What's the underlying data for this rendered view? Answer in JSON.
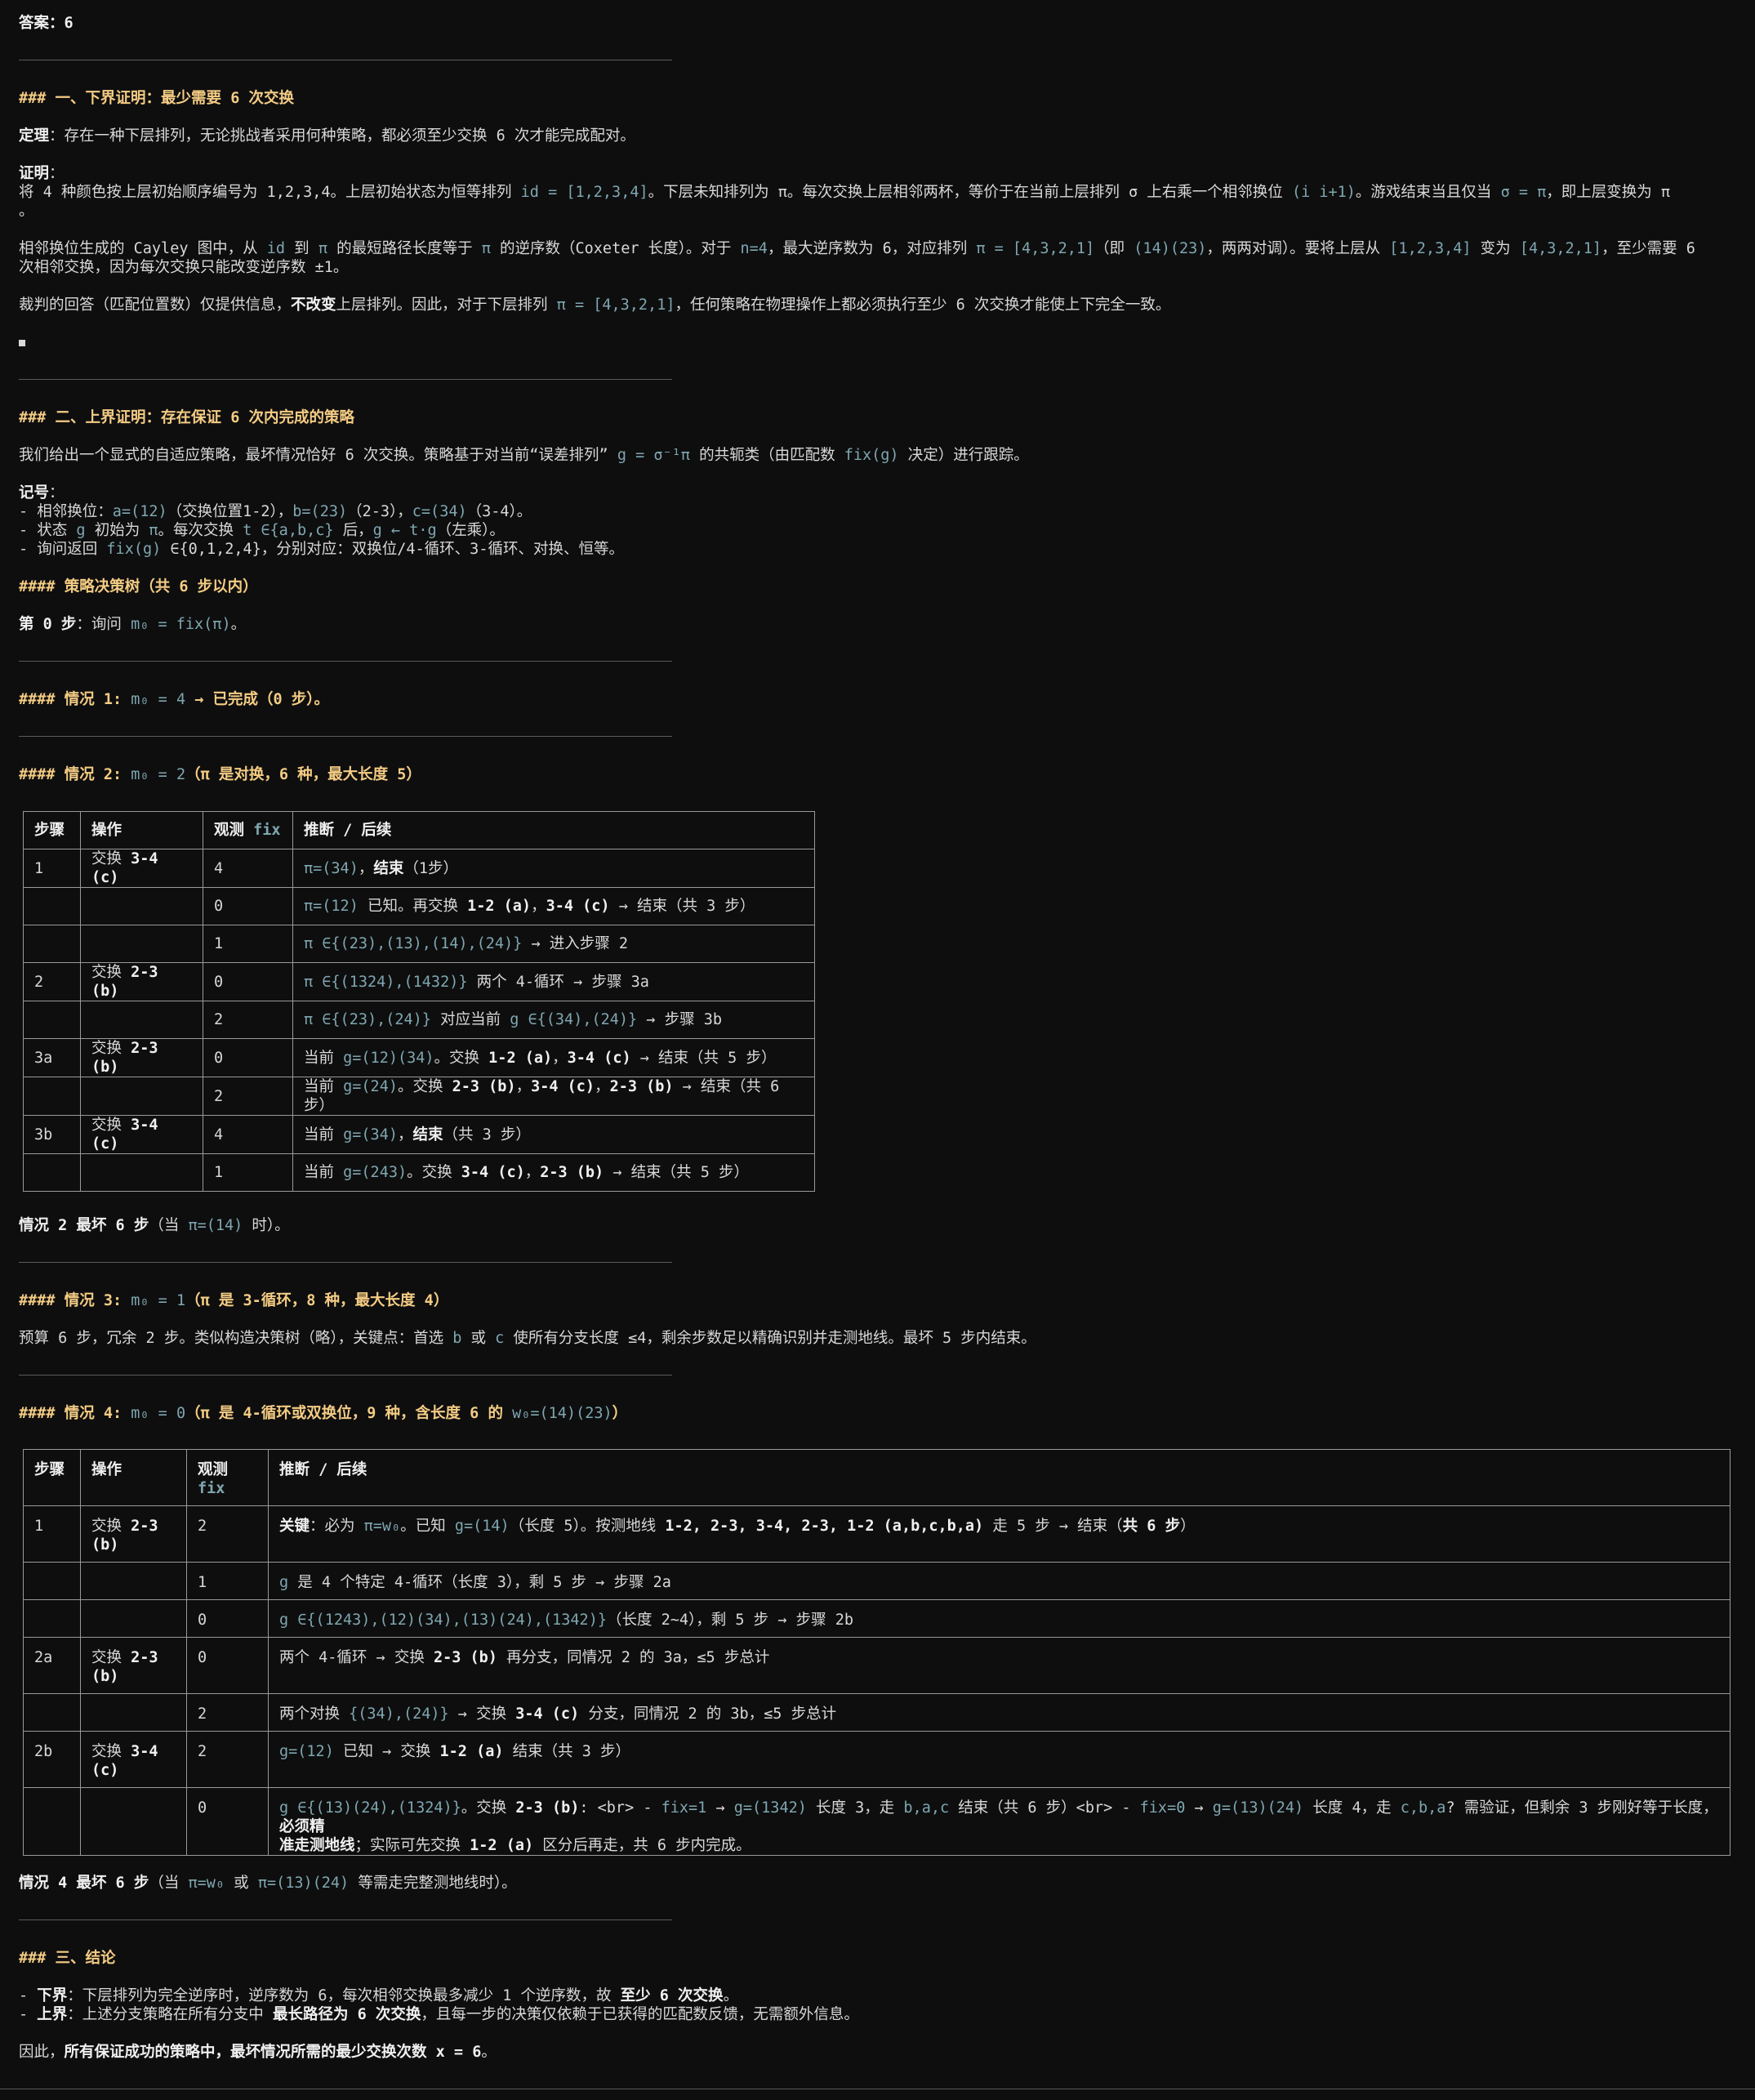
{
  "answer": {
    "label": "答案：",
    "value": "6"
  },
  "sec1": {
    "title": "### 一、下界证明：最少需要 6 次交换",
    "theorem_label": "定理",
    "theorem_text": "：存在一种下层排列，无论挑战者采用何种策略，都必须至少交换 6 次才能完成配对。",
    "proof_label": "证明",
    "p1_a": "将 4 种颜色按上层初始顺序编号为 1,2,3,4。上层初始状态为恒等排列 ",
    "p1_c1": "id = [1,2,3,4]",
    "p1_b": "。下层未知排列为 π。每次交换上层相邻两杯，等价于在当前上层排列 σ 上右乘一个相邻换位 ",
    "p1_c2": "(i i+1)",
    "p1_d": "。游戏结束当且仅当 ",
    "p1_c3": "σ = π",
    "p1_e": "，即上层变换为 π",
    "p1_tail": "。",
    "p2_a": "相邻换位生成的 Cayley 图中，从 ",
    "p2_c1": "id",
    "p2_b": " 到 ",
    "p2_c2": "π",
    "p2_d": " 的最短路径长度等于 ",
    "p2_c3": "π",
    "p2_e": " 的逆序数（Coxeter 长度）。对于 ",
    "p2_c4": "n=4",
    "p2_f": "，最大逆序数为 6，对应排列 ",
    "p2_c5": "π = [4,3,2,1]",
    "p2_g": "（即 ",
    "p2_c6": "(14)(23)",
    "p2_h": "，两两对调）。要将上层从 ",
    "p2_c7": "[1,2,3,4]",
    "p2_i": " 变为 ",
    "p2_c8": "[4,3,2,1]",
    "p2_j": "，至少需要 6",
    "p2_k": "次相邻交换，因为每次交换只能改变逆序数 ±1。",
    "p3_a": "裁判的回答（匹配位置数）仅提供信息，",
    "p3_b": "不改变",
    "p3_c": "上层排列。因此，对于下层排列 ",
    "p3_c1": "π = [4,3,2,1]",
    "p3_d": "，任何策略在物理操作上都必须执行至少 6 次交换才能使上下完全一致。"
  },
  "sec2": {
    "title": "### 二、上界证明：存在保证 6 次内完成的策略",
    "intro_a": "我们给出一个显式的自适应策略，最坏情况恰好 6 次交换。策略基于对当前“误差排列” ",
    "intro_c1": "g = σ⁻¹π",
    "intro_b": " 的共轭类（由匹配数 ",
    "intro_c2": "fix(g)",
    "intro_d": " 决定）进行跟踪。",
    "notation_label": "记号",
    "n1_a": "- 相邻换位：",
    "n1_c1": "a=(12)",
    "n1_b": "（交换位置1-2），",
    "n1_c2": "b=(23)",
    "n1_d": "（2-3），",
    "n1_c3": "c=(34)",
    "n1_e": "（3-4）。",
    "n2_a": "- 状态 ",
    "n2_c1": "g",
    "n2_b": " 初始为 ",
    "n2_c2": "π",
    "n2_d": "。每次交换 ",
    "n2_c3": "t ∈{a,b,c}",
    "n2_e": " 后，",
    "n2_c4": "g ← t·g",
    "n2_f": "（左乘）。",
    "n3_a": "- 询问返回 ",
    "n3_c1": "fix(g)",
    "n3_b": " ∈{0,1,2,4}，分别对应：双换位/4-循环、3-循环、对换、恒等。",
    "tree_title": "#### 策略决策树（共 6 步以内）",
    "step0_label": "第 0 步",
    "step0_a": "：询问 ",
    "step0_c": "m₀ = fix(π)",
    "step0_b": "。",
    "case1_a": "#### 情况 1: ",
    "case1_c": "m₀ = 4",
    "case1_b": " → 已完成（0 步）。",
    "case2_a": "#### 情况 2: ",
    "case2_c": "m₀ = 2",
    "case2_b": "（π 是对换，6 种，最大长度 5）",
    "table1_headers": [
      "步骤",
      "操作",
      "观测 ",
      "fix",
      "推断 / 后续"
    ],
    "case2_sum_a": "情况 2 最坏 6 步",
    "case2_sum_b": "（当 ",
    "case2_sum_c": "π=(14)",
    "case2_sum_d": " 时）。",
    "case3_a": "#### 情况 3: ",
    "case3_c": "m₀ = 1",
    "case3_b": "（π 是 3-循环，8 种，最大长度 4）",
    "case3_text_a": "预算 6 步，冗余 2 步。类似构造决策树（略），关键点：首选 ",
    "case3_c1": "b",
    "case3_text_b": " 或 ",
    "case3_c2": "c",
    "case3_text_c": " 使所有分支长度 ≤4，剩余步数足以精确识别并走测地线。最坏 5 步内结束。",
    "case4_a": "#### 情况 4: ",
    "case4_c": "m₀ = 0",
    "case4_b": "（π 是 4-循环或双换位，9 种，含长度 6 的 ",
    "case4_c2": "w₀=(14)(23)",
    "case4_d": "）",
    "table2_headers": [
      "步骤",
      "操作",
      "观测",
      "fix",
      "推断 / 后续"
    ],
    "case4_sum_a": "情况 4 最坏 6 步",
    "case4_sum_b": "（当 ",
    "case4_sum_c1": "π=w₀",
    "case4_sum_d": " 或 ",
    "case4_sum_c2": "π=(13)(24)",
    "case4_sum_e": " 等需走完整测地线时）。"
  },
  "table1": {
    "r1": {
      "step": "1",
      "op_a": "交换 ",
      "op_b": "3-4 (c)",
      "fix": "4",
      "inf_c1": "π=(34)",
      "inf_a": "，",
      "inf_b": "结束",
      "inf_d": "（1步）"
    },
    "r2": {
      "fix": "0",
      "inf_c1": "π=(12)",
      "inf_a": " 已知。再交换 ",
      "inf_b1": "1-2 (a)",
      "inf_m": "，",
      "inf_b2": "3-4 (c)",
      "inf_d": " → 结束（共 3 步）"
    },
    "r3": {
      "fix": "1",
      "inf_c1": "π ∈{(23),(13),(14),(24)}",
      "inf_a": " → 进入步骤 2"
    },
    "r4": {
      "step": "2",
      "op_a": "交换 ",
      "op_b": "2-3 (b)",
      "fix": "0",
      "inf_c1": "π ∈{(1324),(1432)}",
      "inf_a": " 两个 4-循环 → 步骤 3a"
    },
    "r5": {
      "fix": "2",
      "inf_c1": "π ∈{(23),(24)}",
      "inf_a": " 对应当前 ",
      "inf_c2": "g ∈{(34),(24)}",
      "inf_b": " → 步骤 3b"
    },
    "r6": {
      "step": "3a",
      "op_a": "交换 ",
      "op_b": "2-3 (b)",
      "fix": "0",
      "inf_a": "当前 ",
      "inf_c1": "g=(12)(34)",
      "inf_m": "。交换 ",
      "inf_b1": "1-2 (a)",
      "inf_n": "，",
      "inf_b2": "3-4 (c)",
      "inf_d": " → 结束（共 5 步）"
    },
    "r7": {
      "fix": "2",
      "inf_a": "当前 ",
      "inf_c1": "g=(24)",
      "inf_m": "。交换 ",
      "inf_b1": "2-3 (b)",
      "inf_n": "，",
      "inf_b2": "3-4 (c)",
      "inf_o": "，",
      "inf_b3": "2-3 (b)",
      "inf_d": " → 结束（共 6 步）"
    },
    "r8": {
      "step": "3b",
      "op_a": "交换 ",
      "op_b": "3-4 (c)",
      "fix": "4",
      "inf_a": "当前 ",
      "inf_c1": "g=(34)",
      "inf_m": "，",
      "inf_b1": "结束",
      "inf_d": "（共 3 步）"
    },
    "r9": {
      "fix": "1",
      "inf_a": "当前 ",
      "inf_c1": "g=(243)",
      "inf_m": "。交换 ",
      "inf_b1": "3-4 (c)",
      "inf_n": "，",
      "inf_b2": "2-3 (b)",
      "inf_d": " → 结束（共 5 步）"
    }
  },
  "table2": {
    "r1": {
      "step": "1",
      "op_a": "交换 ",
      "op_b1": "2-3",
      "op_b2": "(b)",
      "fix": "2",
      "inf_b0": "关键",
      "inf_a": "：必为 ",
      "inf_c1": "π=w₀",
      "inf_m": "。已知 ",
      "inf_c2": "g=(14)",
      "inf_n": "（长度 5）。按测地线 ",
      "inf_b1": "1-2, 2-3, 3-4, 2-3, 1-2 (a,b,c,b,a)",
      "inf_o": " 走 5 步 → 结束（",
      "inf_b2": "共 6 步",
      "inf_d": "）"
    },
    "r2": {
      "fix": "1",
      "inf_c1": "g",
      "inf_a": " 是 4 个特定 4-循环（长度 3），剩 5 步 → 步骤 2a"
    },
    "r3": {
      "fix": "0",
      "inf_c1": "g ∈{(1243),(12)(34),(13)(24),(1342)}",
      "inf_a": "（长度 2~4），剩 5 步 → 步骤 2b"
    },
    "r4": {
      "step": "2a",
      "op_a": "交换 ",
      "op_b1": "2-3",
      "op_b2": "(b)",
      "fix": "0",
      "inf_a": "两个 4-循环 → 交换 ",
      "inf_b1": "2-3 (b)",
      "inf_d": " 再分支，同情况 2 的 3a，≤5 步总计"
    },
    "r5": {
      "fix": "2",
      "inf_a": "两个对换 ",
      "inf_c1": "{(34),(24)}",
      "inf_m": " → 交换 ",
      "inf_b1": "3-4 (c)",
      "inf_d": " 分支，同情况 2 的 3b，≤5 步总计"
    },
    "r6": {
      "step": "2b",
      "op_a": "交换 ",
      "op_b1": "3-4",
      "op_b2": "(c)",
      "fix": "2",
      "inf_c1": "g=(12)",
      "inf_a": " 已知 → 交换 ",
      "inf_b1": "1-2 (a)",
      "inf_d": " 结束（共 3 步）"
    },
    "r7": {
      "fix": "0",
      "inf_c1": "g ∈{(13)(24),(1324)}",
      "inf_a": "。交换 ",
      "inf_b1": "2-3 (b)",
      "inf_m": ": <br> - ",
      "inf_c2": "fix=1",
      "inf_n": " → ",
      "inf_c3": "g=(1342)",
      "inf_o": " 长度 3，走 ",
      "inf_c4": "b,a,c",
      "inf_p": " 结束（共 6 步）<br> - ",
      "inf_c5": "fix=0",
      "inf_q": " → ",
      "inf_c6": "g=(13)(24)",
      "inf_r": " 长度 4，走 ",
      "inf_c7": "c,b,a",
      "inf_s": "? 需验证，但剩余 3 步刚好等于长度，",
      "inf_b2": "必须精",
      "inf_b3": "准走测地线",
      "inf_t": "；实际可先交换 ",
      "inf_b4": "1-2 (a)",
      "inf_u": " 区分后再走，共 6 步内完成。"
    }
  },
  "sec3": {
    "title": "### 三、结论",
    "l1_a": "- ",
    "l1_b": "下界",
    "l1_c": "：下层排列为完全逆序时，逆序数为 6，每次相邻交换最多减少 1 个逆序数，故 ",
    "l1_d": "至少 6 次交换",
    "l1_e": "。",
    "l2_a": "- ",
    "l2_b": "上界",
    "l2_c": "：上述分支策略在所有分支中 ",
    "l2_d": "最长路径为 6 次交换",
    "l2_e": "，且每一步的决策仅依赖于已获得的匹配数反馈，无需额外信息。",
    "final_a": "因此，",
    "final_b": "所有保证成功的策略中，最坏情况所需的最少交换次数 x = 6",
    "final_c": "。"
  }
}
